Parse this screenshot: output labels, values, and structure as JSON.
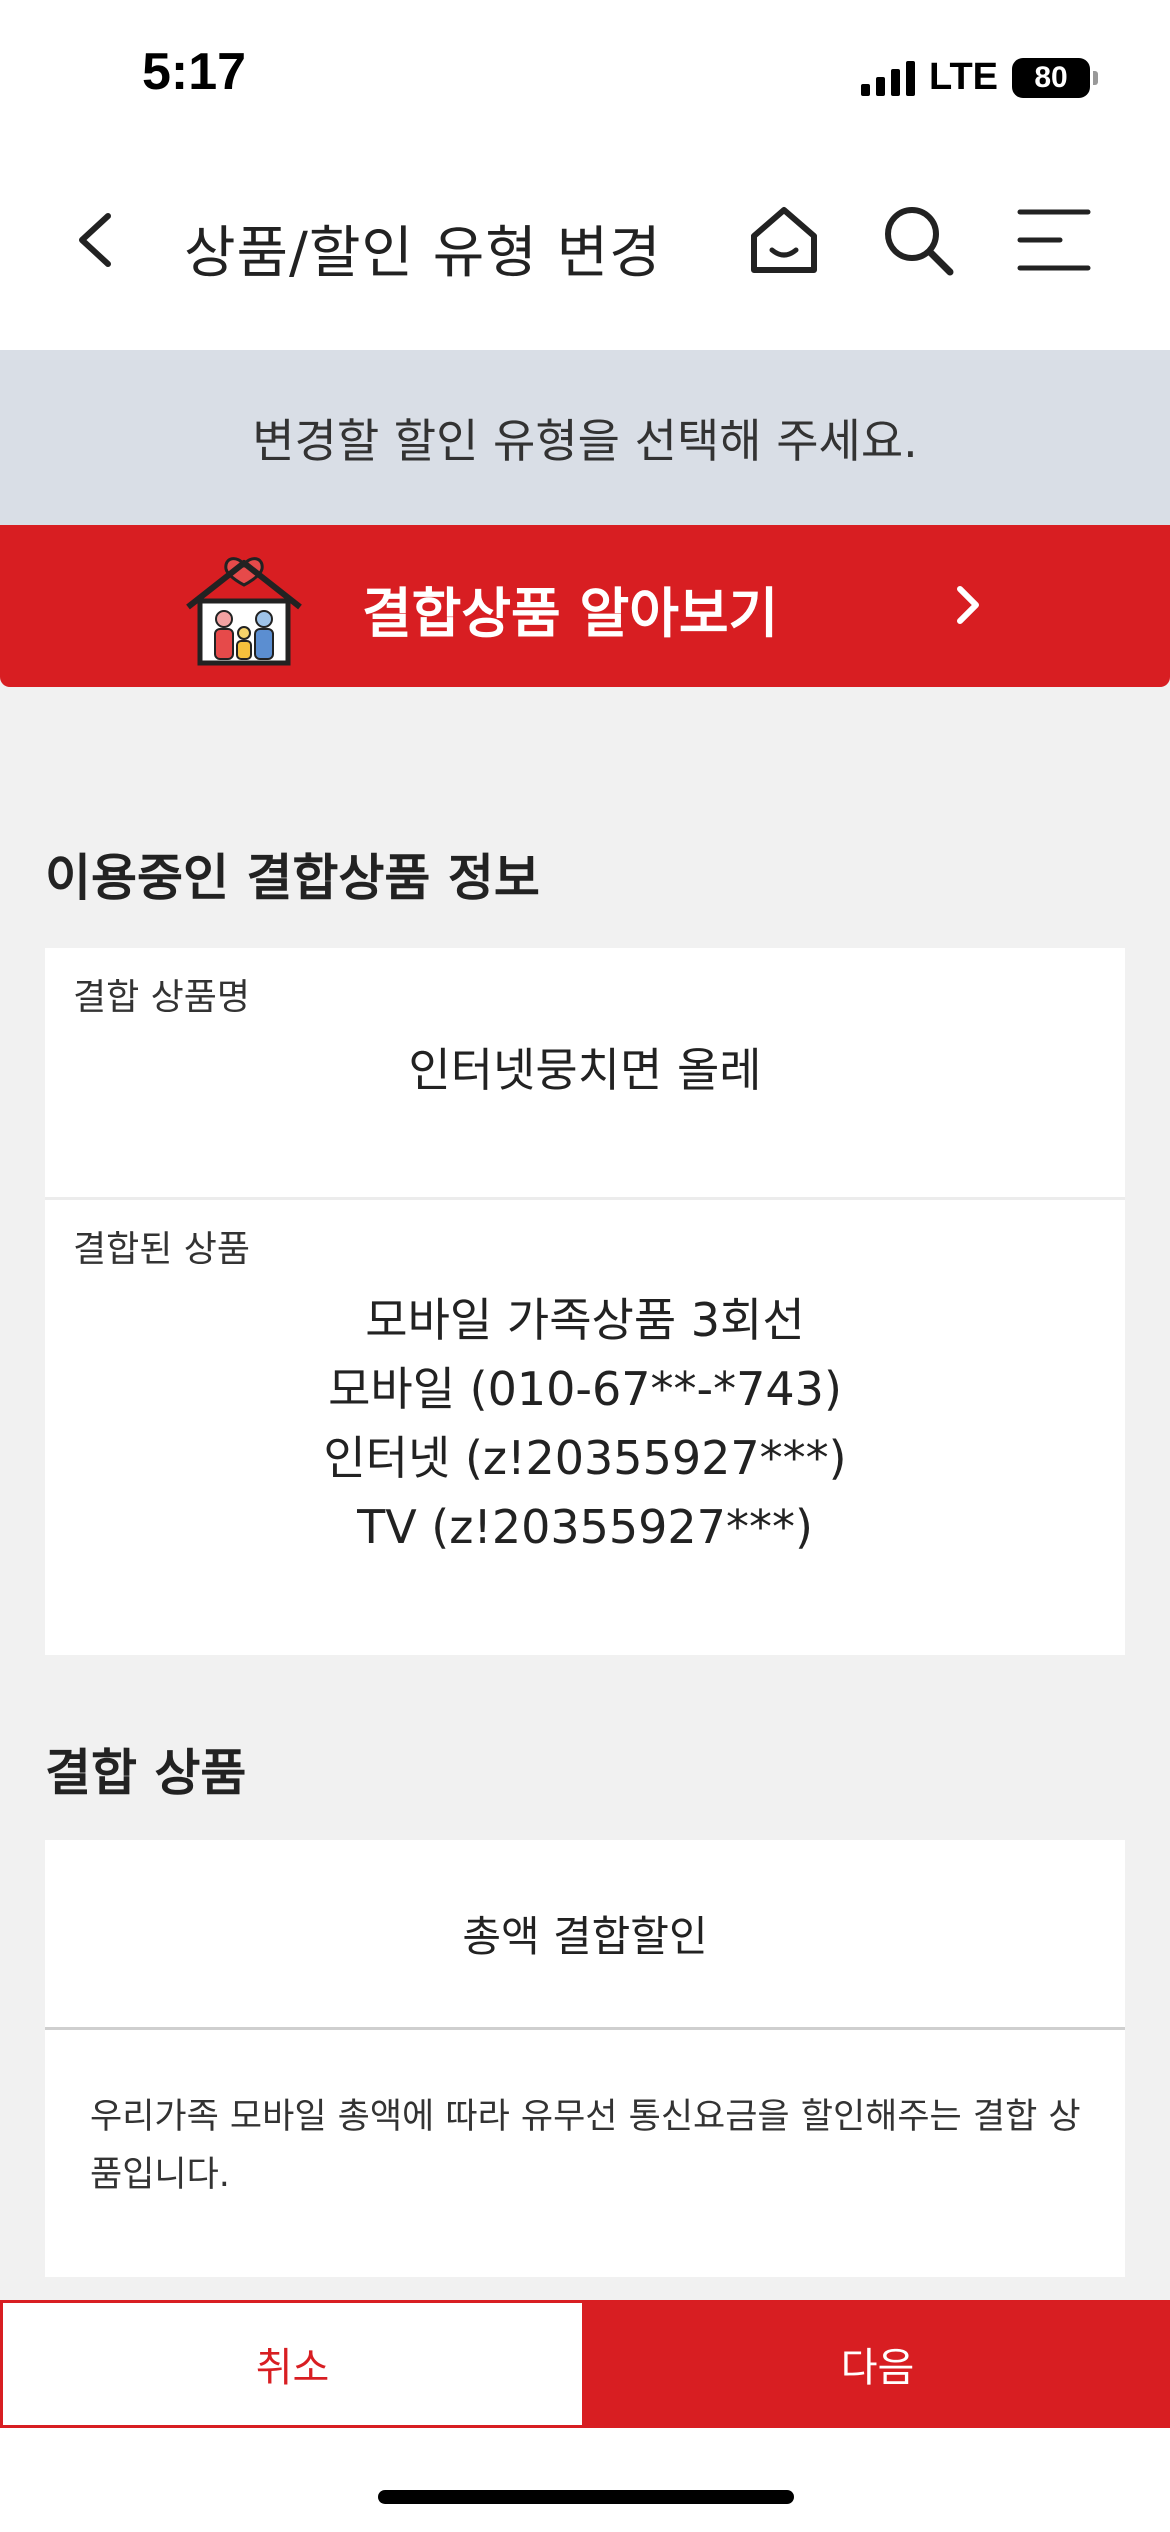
{
  "status_bar": {
    "time": "5:17",
    "network": "LTE",
    "battery": "80"
  },
  "header": {
    "title": "상품/할인 유형 변경",
    "icons": [
      "back-arrow-icon",
      "home-icon",
      "search-icon",
      "menu-icon"
    ]
  },
  "notice": "변경할 할인 유형을 선택해 주세요.",
  "banner": {
    "label": "결합상품 알아보기",
    "icon": "family-house-icon"
  },
  "current_bundle": {
    "section_title": "이용중인 결합상품 정보",
    "name_label": "결합 상품명",
    "name_value": "인터넷뭉치면 올레",
    "linked_label": "결합된 상품",
    "linked_items": [
      "모바일 가족상품 3회선",
      "모바일 (010-67**-*743)",
      "인터넷 (z!20355927***)",
      "TV (z!20355927***)"
    ]
  },
  "bundle_product": {
    "section_title": "결합 상품",
    "option": "총액 결합할인",
    "description": "우리가족 모바일 총액에 따라 유무선 통신요금을 할인해주는 결합 상품입니다."
  },
  "actions": {
    "cancel": "취소",
    "next": "다음"
  },
  "colors": {
    "brand_red": "#d81e22",
    "notice_bg": "#d9dee6",
    "page_bg": "#f1f1f1"
  }
}
